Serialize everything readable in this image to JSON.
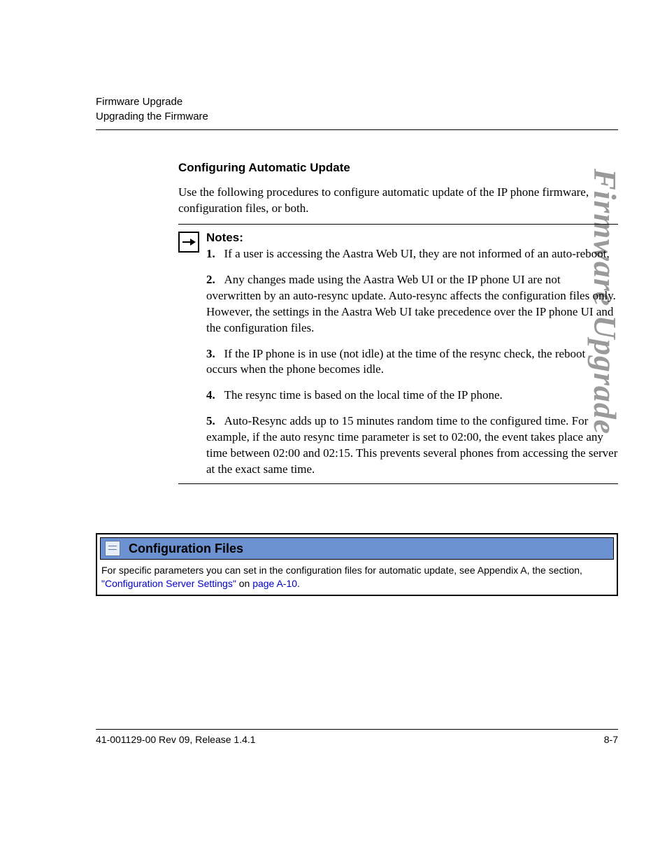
{
  "header": {
    "line1": "Firmware Upgrade",
    "line2": "Upgrading the Firmware"
  },
  "sideTitle": "Firmware Upgrade",
  "section": {
    "title": "Configuring Automatic Update",
    "intro": "Use the following procedures to configure automatic update of the IP phone firmware, configuration files, or both."
  },
  "notes": {
    "heading": "Notes:",
    "items": [
      {
        "num": "1.",
        "text": "If a user is accessing the Aastra Web UI, they are not informed of an auto-reboot."
      },
      {
        "num": "2.",
        "text": "Any changes made using the Aastra Web UI or the IP phone UI are not overwritten by an auto-resync update.  Auto-resync affects the configuration files only.  However, the settings in the Aastra Web UI take precedence over the IP phone UI and the configuration files."
      },
      {
        "num": "3.",
        "text": "If the IP phone is in use (not idle) at the time of the resync check, the reboot occurs when the phone becomes idle."
      },
      {
        "num": "4.",
        "text": "The resync time is based on the local time of the IP phone."
      },
      {
        "num": "5.",
        "text": "Auto-Resync adds up to 15 minutes random time to the configured time.  For example, if the auto resync time parameter is set to 02:00, the event takes place any time between 02:00 and 02:15.  This prevents several phones from accessing the server at the exact same time."
      }
    ]
  },
  "configBox": {
    "title": "Configuration Files",
    "bodyPrefix": "For specific parameters you can set in the configuration files for automatic update, see Appendix A, the section, ",
    "link1": "\"Configuration Server Settings\"",
    "mid": " on ",
    "link2": "page A-10",
    "suffix": "."
  },
  "footer": {
    "left": "41-001129-00 Rev 09, Release 1.4.1",
    "right": "8-7"
  }
}
